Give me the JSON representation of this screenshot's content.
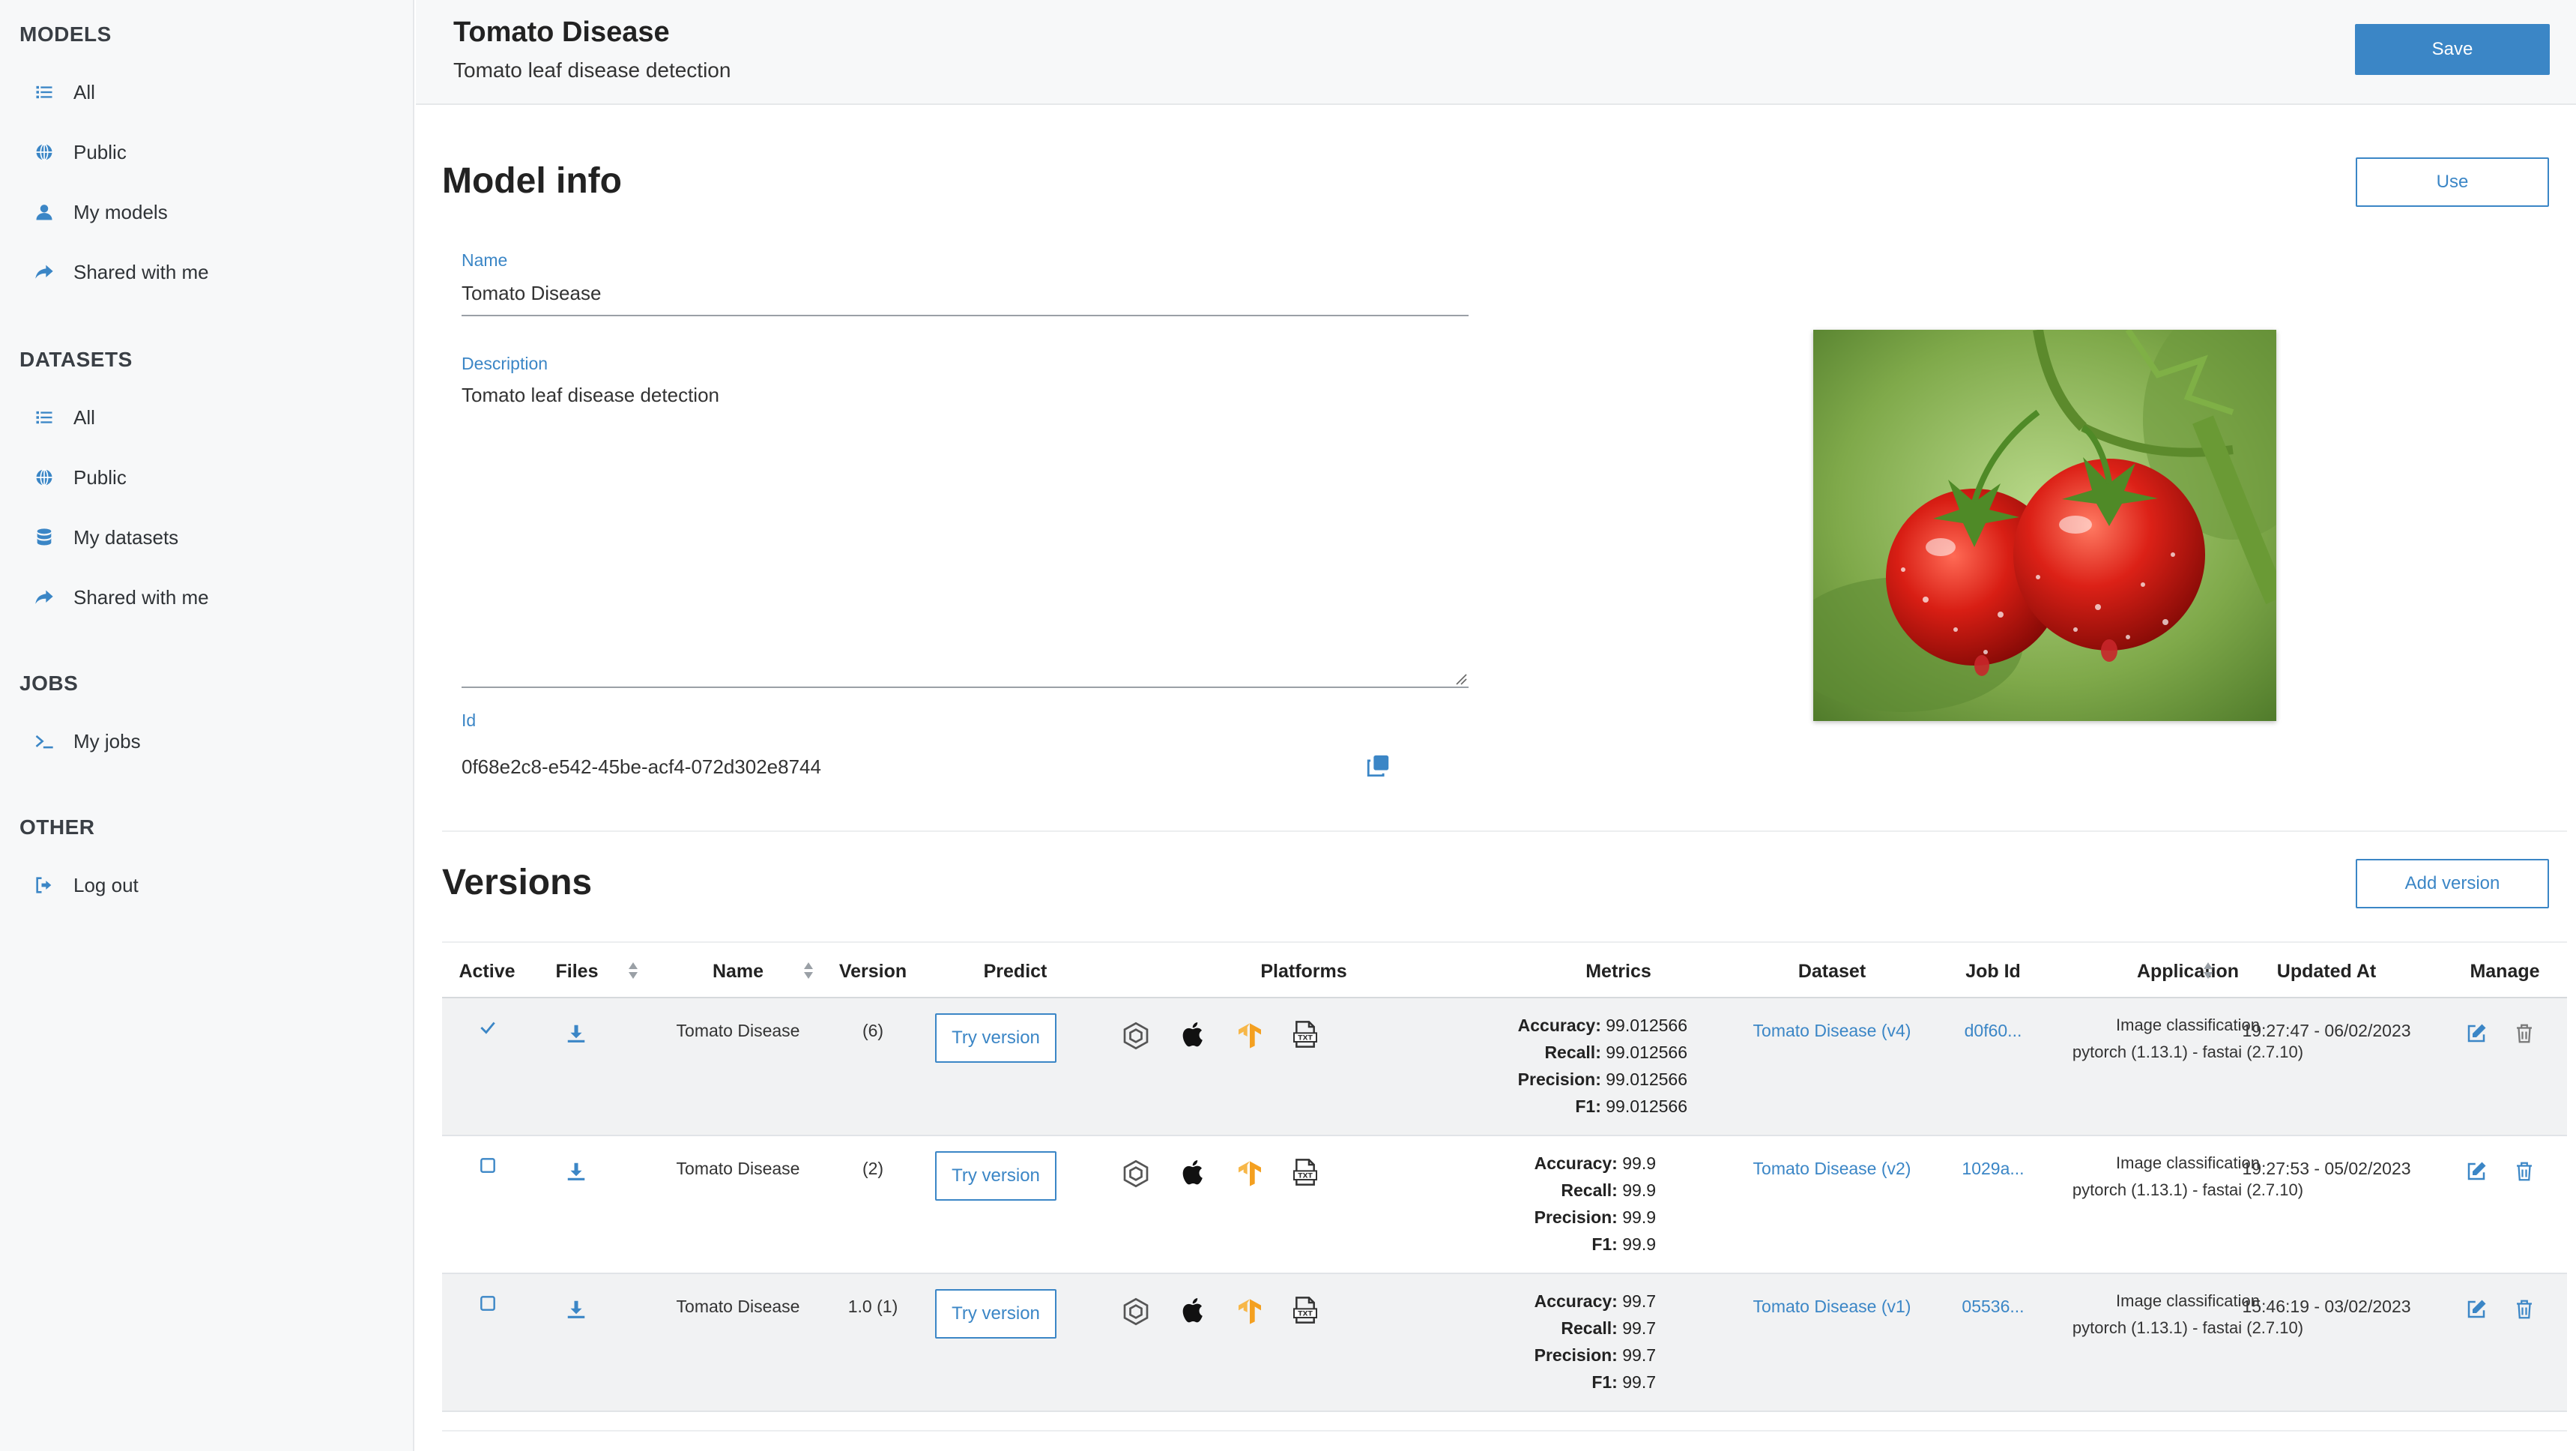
{
  "sidebar": {
    "sections": [
      {
        "title": "MODELS",
        "items": [
          {
            "label": "All",
            "icon": "list-icon"
          },
          {
            "label": "Public",
            "icon": "globe-icon"
          },
          {
            "label": "My models",
            "icon": "user-icon"
          },
          {
            "label": "Shared with me",
            "icon": "share-icon"
          }
        ]
      },
      {
        "title": "DATASETS",
        "items": [
          {
            "label": "All",
            "icon": "list-icon"
          },
          {
            "label": "Public",
            "icon": "globe-icon"
          },
          {
            "label": "My datasets",
            "icon": "database-icon"
          },
          {
            "label": "Shared with me",
            "icon": "share-icon"
          }
        ]
      },
      {
        "title": "JOBS",
        "items": [
          {
            "label": "My jobs",
            "icon": "terminal-icon"
          }
        ]
      },
      {
        "title": "OTHER",
        "items": [
          {
            "label": "Log out",
            "icon": "logout-icon"
          }
        ]
      }
    ]
  },
  "header": {
    "title": "Tomato Disease",
    "subtitle": "Tomato leaf disease detection",
    "save_label": "Save"
  },
  "model_info": {
    "title": "Model info",
    "use_label": "Use",
    "name_label": "Name",
    "name_value": "Tomato Disease",
    "description_label": "Description",
    "description_value": "Tomato leaf disease detection",
    "id_label": "Id",
    "id_value": "0f68e2c8-e542-45be-acf4-072d302e8744"
  },
  "versions": {
    "title": "Versions",
    "add_label": "Add version",
    "columns": [
      "Active",
      "Files",
      "Name",
      "Version",
      "Predict",
      "Platforms",
      "Metrics",
      "Dataset",
      "Job Id",
      "Application",
      "Updated At",
      "Manage"
    ],
    "try_label": "Try version",
    "rows": [
      {
        "active": true,
        "name": "Tomato Disease",
        "version": "(6)",
        "metrics": {
          "accuracy": "99.012566",
          "recall": "99.012566",
          "precision": "99.012566",
          "f1": "99.012566"
        },
        "dataset": "Tomato Disease (v4)",
        "job_id": "d0f60...",
        "application": "Image classification",
        "framework": "pytorch (1.13.1) - fastai (2.7.10)",
        "updated_at": "19:27:47 - 06/02/2023"
      },
      {
        "active": false,
        "name": "Tomato Disease",
        "version": "(2)",
        "metrics": {
          "accuracy": "99.9",
          "recall": "99.9",
          "precision": "99.9",
          "f1": "99.9"
        },
        "dataset": "Tomato Disease (v2)",
        "job_id": "1029a...",
        "application": "Image classification",
        "framework": "pytorch (1.13.1) - fastai (2.7.10)",
        "updated_at": "19:27:53 - 05/02/2023"
      },
      {
        "active": false,
        "name": "Tomato Disease",
        "version": "1.0 (1)",
        "metrics": {
          "accuracy": "99.7",
          "recall": "99.7",
          "precision": "99.7",
          "f1": "99.7"
        },
        "dataset": "Tomato Disease (v1)",
        "job_id": "05536...",
        "application": "Image classification",
        "framework": "pytorch (1.13.1) - fastai (2.7.10)",
        "updated_at": "15:46:19 - 03/02/2023"
      }
    ],
    "metric_labels": {
      "accuracy": "Accuracy:",
      "recall": "Recall:",
      "precision": "Precision:",
      "f1": "F1:"
    }
  },
  "colors": {
    "accent": "#3b86c6",
    "sidebar_bg": "#f7f8f9",
    "row_shade": "#f1f2f3"
  }
}
